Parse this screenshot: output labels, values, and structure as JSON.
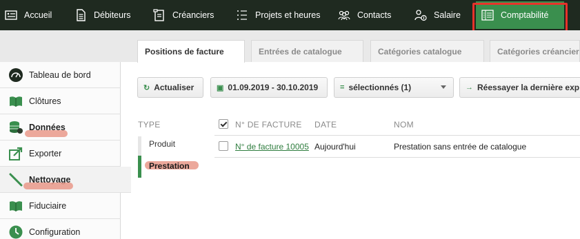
{
  "topnav": {
    "items": [
      {
        "label": "Accueil",
        "icon": "home-list-icon"
      },
      {
        "label": "Débiteurs",
        "icon": "document-icon"
      },
      {
        "label": "Créanciers",
        "icon": "invoice-icon"
      },
      {
        "label": "Projets et heures",
        "icon": "checklist-icon"
      },
      {
        "label": "Contacts",
        "icon": "people-icon"
      },
      {
        "label": "Salaire",
        "icon": "salary-icon"
      },
      {
        "label": "Comptabilité",
        "icon": "ledger-icon"
      }
    ],
    "active": "Comptabilité",
    "highlight_color": "#e8322a"
  },
  "tabs": [
    {
      "label": "Positions de facture",
      "active": true
    },
    {
      "label": "Entrées de catalogue",
      "active": false
    },
    {
      "label": "Catégories catalogue",
      "active": false
    },
    {
      "label": "Catégories créancier",
      "active": false
    }
  ],
  "sidebar": {
    "items": [
      {
        "label": "Tableau de bord",
        "icon": "dashboard-icon"
      },
      {
        "label": "Clôtures",
        "icon": "book-icon"
      },
      {
        "label": "Données",
        "icon": "database-icon"
      },
      {
        "label": "Exporter",
        "icon": "export-icon"
      },
      {
        "label": "Nettoyage",
        "icon": "broom-icon"
      },
      {
        "label": "Fiduciaire",
        "icon": "book-icon"
      },
      {
        "label": "Configuration",
        "icon": "clock-icon"
      }
    ],
    "active": "Nettoyage"
  },
  "toolbar": {
    "refresh_label": "Actualiser",
    "date_range": "01.09.2019 - 30.10.2019",
    "selection": "sélectionnés (1)",
    "retry_label": "Réessayer la dernière exp"
  },
  "filter": {
    "header": "TYPE",
    "items": [
      "Produit",
      "Prestation"
    ],
    "active": "Prestation"
  },
  "table": {
    "columns": [
      "N° DE FACTURE",
      "DATE",
      "NOM"
    ],
    "rows": [
      {
        "invoice": "N° de facture 10005",
        "date": "Aujourd'hui",
        "name": "Prestation sans entrée de catalogue"
      }
    ]
  },
  "colors": {
    "nav_bg": "#1f2a20",
    "accent_green": "#3a8f4e",
    "annotation": "#e9998a"
  }
}
